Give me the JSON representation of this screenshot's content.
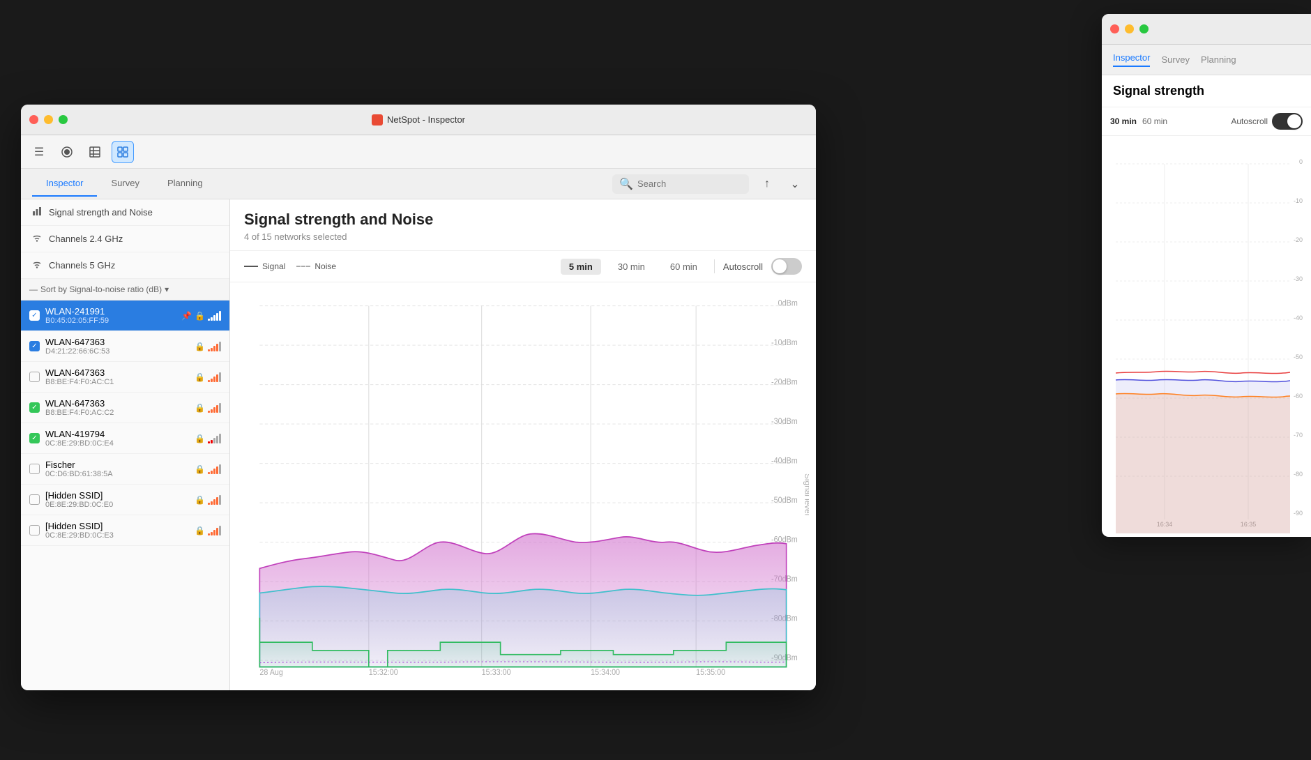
{
  "app": {
    "title": "NetSpot - Inspector",
    "icon": "netspot-icon"
  },
  "toolbar": {
    "menu_icon": "☰",
    "record_icon": "⏺",
    "table_icon": "▦",
    "grid_icon": "⊞"
  },
  "nav": {
    "tabs": [
      {
        "label": "Inspector",
        "active": true
      },
      {
        "label": "Survey",
        "active": false
      },
      {
        "label": "Planning",
        "active": false
      }
    ],
    "search_placeholder": "Search"
  },
  "sidebar": {
    "menu_items": [
      {
        "icon": "📊",
        "label": "Signal strength and Noise"
      },
      {
        "icon": "📡",
        "label": "Channels 2.4 GHz"
      },
      {
        "icon": "📡",
        "label": "Channels 5 GHz"
      }
    ],
    "sort_label": "Sort by Signal-to-noise ratio (dB)",
    "networks": [
      {
        "name": "WLAN-241991",
        "mac": "B0:45:02:05:FF:59",
        "checked": true,
        "selected": true,
        "lock": true,
        "pin": true,
        "signal": 5,
        "color": "orange"
      },
      {
        "name": "WLAN-647363",
        "mac": "D4:21:22:66:6C:53",
        "checked": true,
        "selected": false,
        "lock": true,
        "signal": 4,
        "color": "orange"
      },
      {
        "name": "WLAN-647363",
        "mac": "B8:BE:F4:F0:AC:C1",
        "checked": false,
        "selected": false,
        "lock": true,
        "signal": 4,
        "color": "orange"
      },
      {
        "name": "WLAN-647363",
        "mac": "B8:BE:F4:F0:AC:C2",
        "checked": true,
        "selected": false,
        "lock": true,
        "signal": 4,
        "color": "orange"
      },
      {
        "name": "WLAN-419794",
        "mac": "0C:8E:29:BD:0C:E4",
        "checked": true,
        "selected": false,
        "lock": true,
        "signal": 2,
        "color": "red"
      },
      {
        "name": "Fischer",
        "mac": "0C:D6:BD:61:38:5A",
        "checked": false,
        "selected": false,
        "lock": true,
        "signal": 4,
        "color": "orange"
      },
      {
        "name": "[Hidden SSID]",
        "mac": "0E:8E:29:BD:0C:E0",
        "checked": false,
        "selected": false,
        "lock": true,
        "signal": 4,
        "color": "orange"
      },
      {
        "name": "[Hidden SSID]",
        "mac": "0C:8E:29:BD:0C:E3",
        "checked": false,
        "selected": false,
        "lock": true,
        "signal": 4,
        "color": "orange"
      }
    ]
  },
  "chart": {
    "title": "Signal strength and Noise",
    "subtitle": "4 of 15 networks selected",
    "legend": {
      "signal_label": "Signal",
      "noise_label": "Noise"
    },
    "time_buttons": [
      "5 min",
      "30 min",
      "60 min"
    ],
    "active_time": "5 min",
    "autoscroll_label": "Autoscroll",
    "autoscroll_on": false,
    "x_labels": [
      "15:32:00",
      "15:33:00",
      "15:34:00",
      "15:35:00"
    ],
    "date_label": "28 Aug",
    "y_labels": [
      "0dBm",
      "-10dBm",
      "-20dBm",
      "-30dBm",
      "-40dBm",
      "-50dBm",
      "-60dBm",
      "-70dBm",
      "-80dBm",
      "-90dBm"
    ],
    "signal_level_label": "Signal level"
  },
  "right_panel": {
    "title": "Signal strength",
    "nav_labels": [
      "Inspector",
      "Survey",
      "Planning"
    ],
    "time_buttons": [
      "30 min",
      "60 min"
    ],
    "autoscroll_label": "Autoscroll",
    "x_labels": [
      "16:34",
      "16:35"
    ],
    "y_labels": [
      "0",
      "-10",
      "-20",
      "-30",
      "-40",
      "-50",
      "-60",
      "-70",
      "-80",
      "-90"
    ]
  }
}
